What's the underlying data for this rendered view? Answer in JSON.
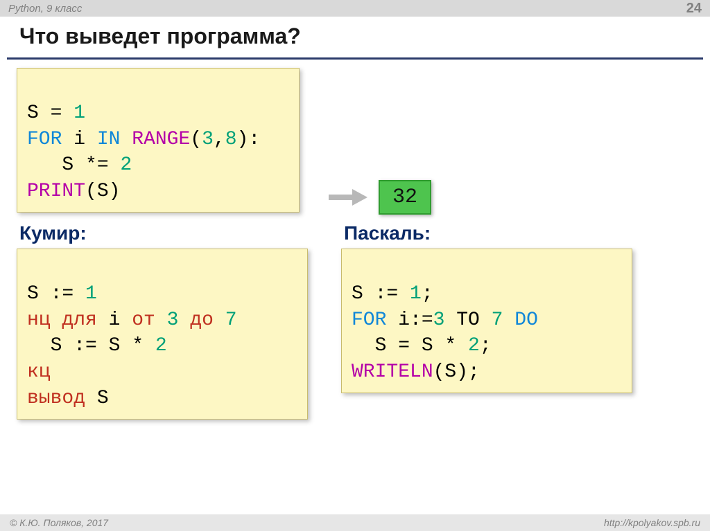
{
  "header": {
    "left": "Python, 9 класс",
    "pageNumber": "24"
  },
  "title": "Что выведет программа?",
  "python": {
    "l1_a": "S = ",
    "l1_b": "1",
    "l2_a": "FOR",
    "l2_b": " i ",
    "l2_c": "IN",
    "l2_d": " ",
    "l2_e": "RANGE",
    "l2_f": "(",
    "l2_g": "3",
    "l2_h": ",",
    "l2_i": "8",
    "l2_j": "):",
    "l3_a": "   S *= ",
    "l3_b": "2",
    "l4_a": "PRINT",
    "l4_b": "(S)"
  },
  "answer": "32",
  "kumir": {
    "heading": "Кумир:",
    "l1_a": "S := ",
    "l1_b": "1",
    "l2_a": "нц для",
    "l2_b": " i ",
    "l2_c": "от",
    "l2_d": " ",
    "l2_e": "3",
    "l2_f": " ",
    "l2_g": "до",
    "l2_h": " ",
    "l2_i": "7",
    "l3_a": "  S := S * ",
    "l3_b": "2",
    "l4_a": "кц",
    "l5_a": "вывод",
    "l5_b": " S"
  },
  "pascal": {
    "heading": "Паскаль:",
    "l1_a": "S := ",
    "l1_b": "1",
    "l1_c": ";",
    "l2_a": "FOR",
    "l2_b": " i:=",
    "l2_c": "3",
    "l2_d": " TO ",
    "l2_e": "7",
    "l2_f": " DO",
    "l3_a": "  S = S * ",
    "l3_b": "2",
    "l3_c": ";",
    "l4_a": "WRITELN",
    "l4_b": "(S);"
  },
  "footer": {
    "left": "© К.Ю. Поляков, 2017",
    "right": "http://kpolyakov.spb.ru"
  }
}
